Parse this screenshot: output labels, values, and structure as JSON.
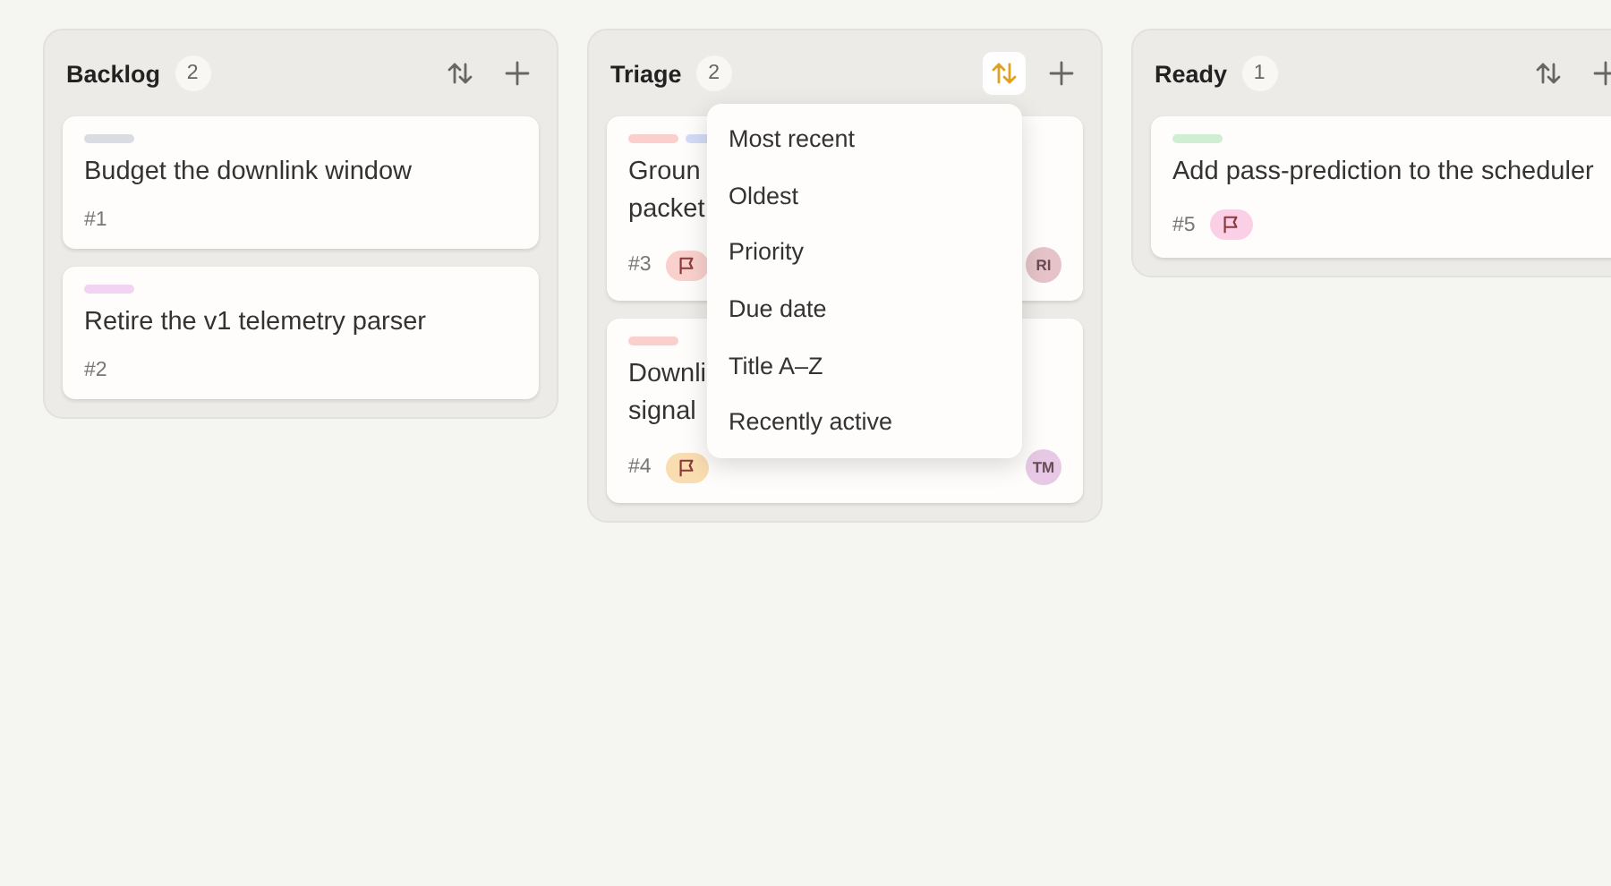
{
  "columns": [
    {
      "title": "Backlog",
      "count": "2",
      "sort_active": false,
      "cards": [
        {
          "labels": [
            {
              "color": "#d9dce0"
            }
          ],
          "title_lines": [
            "Budget the downlink window"
          ],
          "number": "#1"
        },
        {
          "labels": [
            {
              "color": "#f3d3f3"
            }
          ],
          "title_lines": [
            "Retire the v1 telemetry parser"
          ],
          "number": "#2"
        }
      ]
    },
    {
      "title": "Triage",
      "count": "2",
      "sort_active": true,
      "cards": [
        {
          "labels": [
            {
              "color": "#fbcfcb"
            },
            {
              "color": "#d3dbf7"
            }
          ],
          "title_lines": [
            "Groun",
            "packet"
          ],
          "number": "#3",
          "flag": {
            "color": "#f9d0cc"
          },
          "assignee": {
            "initials": "RI",
            "color": "#e5c3c8"
          }
        },
        {
          "labels": [
            {
              "color": "#fbcfcb"
            }
          ],
          "title_lines": [
            "Downli",
            "signal"
          ],
          "number": "#4",
          "flag": {
            "color": "#f9dcb0"
          },
          "assignee": {
            "initials": "TM",
            "color": "#e7c9e6"
          }
        }
      ]
    },
    {
      "title": "Ready",
      "count": "1",
      "sort_active": false,
      "cards": [
        {
          "labels": [
            {
              "color": "#cfeed2"
            }
          ],
          "title_lines": [
            "Add pass-prediction to the scheduler"
          ],
          "number": "#5",
          "flag": {
            "color": "#fbd0e6"
          }
        }
      ]
    }
  ],
  "sort_menu": {
    "items": [
      "Most recent",
      "Oldest",
      "Priority",
      "Due date",
      "Title A–Z",
      "Recently active"
    ]
  }
}
